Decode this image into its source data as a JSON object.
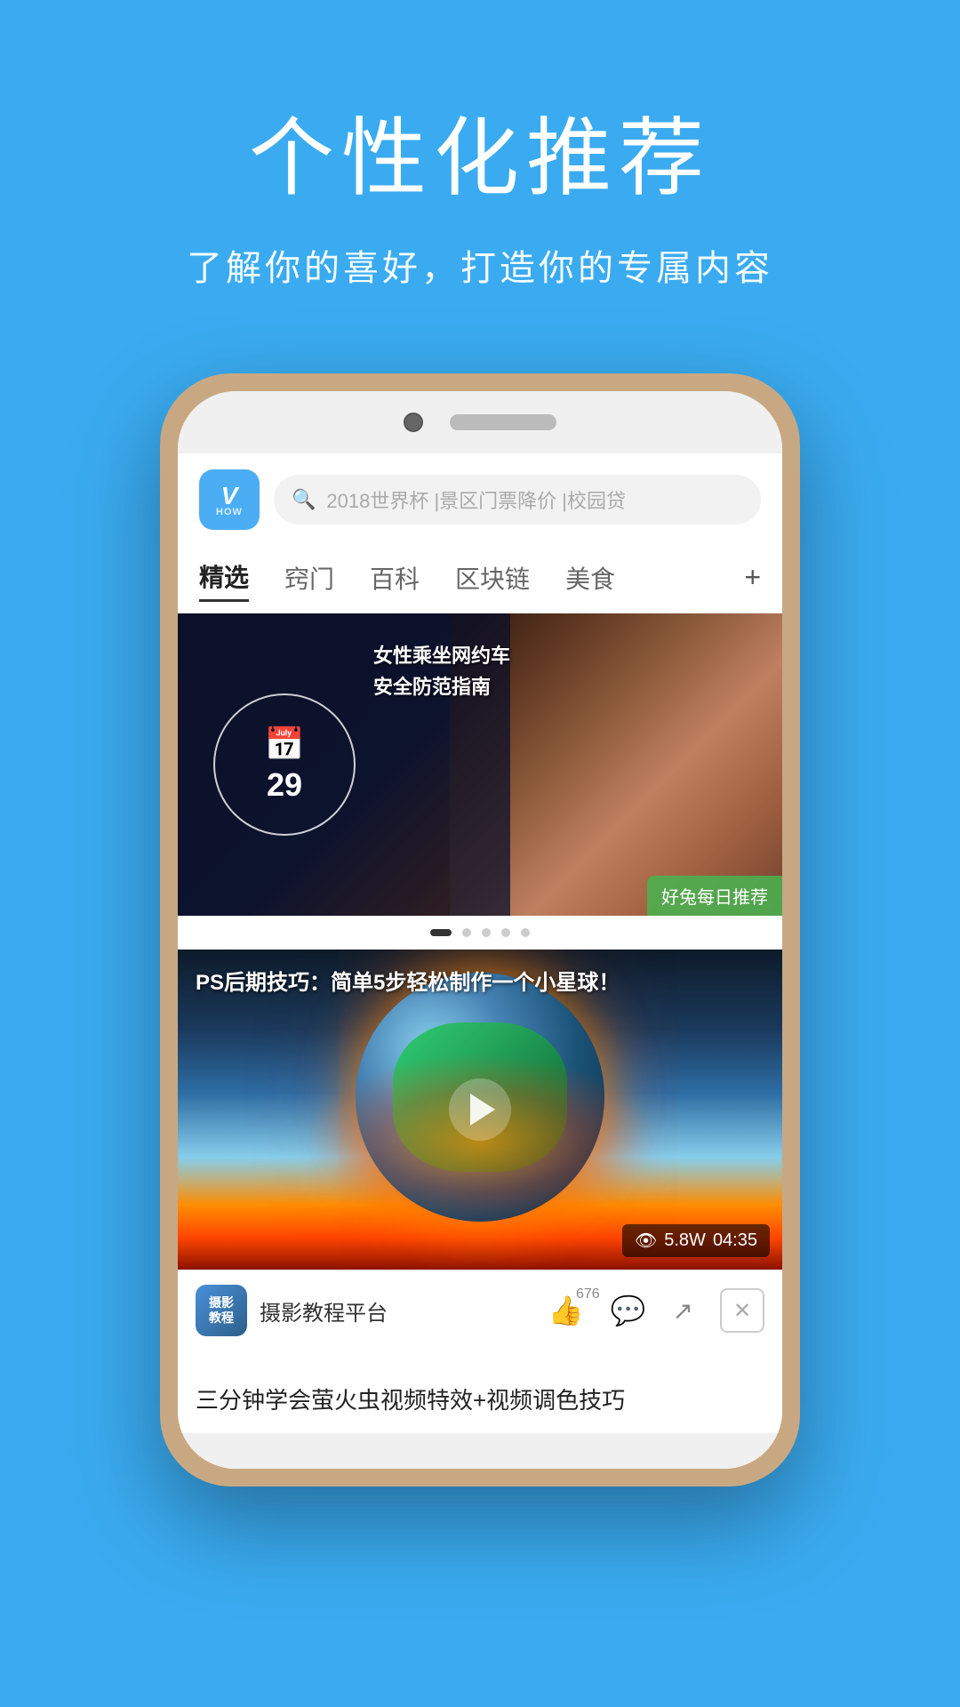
{
  "background_color": "#3aabf0",
  "header": {
    "title": "个性化推荐",
    "subtitle": "了解你的喜好，打造你的专属内容"
  },
  "app": {
    "logo_letter": "V",
    "logo_sub": "HOW",
    "search_placeholder": "2018世界杯 |景区门票降价 |校园贷"
  },
  "nav": {
    "tabs": [
      {
        "label": "精选",
        "active": true
      },
      {
        "label": "窍门",
        "active": false
      },
      {
        "label": "百科",
        "active": false
      },
      {
        "label": "区块链",
        "active": false
      },
      {
        "label": "美食",
        "active": false
      }
    ],
    "plus_label": "+"
  },
  "banner": {
    "calendar_date": "29",
    "lines": [
      "女性",
      "乘坐",
      "网约",
      "车"
    ],
    "side_text1": "安全",
    "side_text2": "防范",
    "side_text3": "指南",
    "badge": "好兔每日推荐",
    "dots_count": 5,
    "active_dot": 0
  },
  "video_card": {
    "title": "PS后期技巧：简单5步轻松制作一个小星球！",
    "views": "5.8W",
    "duration": "04:35",
    "author_avatar_text1": "摄影",
    "author_avatar_text2": "教程",
    "author_name": "摄影教程平台",
    "like_count": "676"
  },
  "next_article": {
    "title": "三分钟学会萤火虫视频特效+视频调色技巧"
  },
  "icons": {
    "search": "🔍",
    "play": "▶",
    "like": "👍",
    "comment": "💬",
    "share": "↗",
    "close": "×",
    "eye": "👁"
  }
}
